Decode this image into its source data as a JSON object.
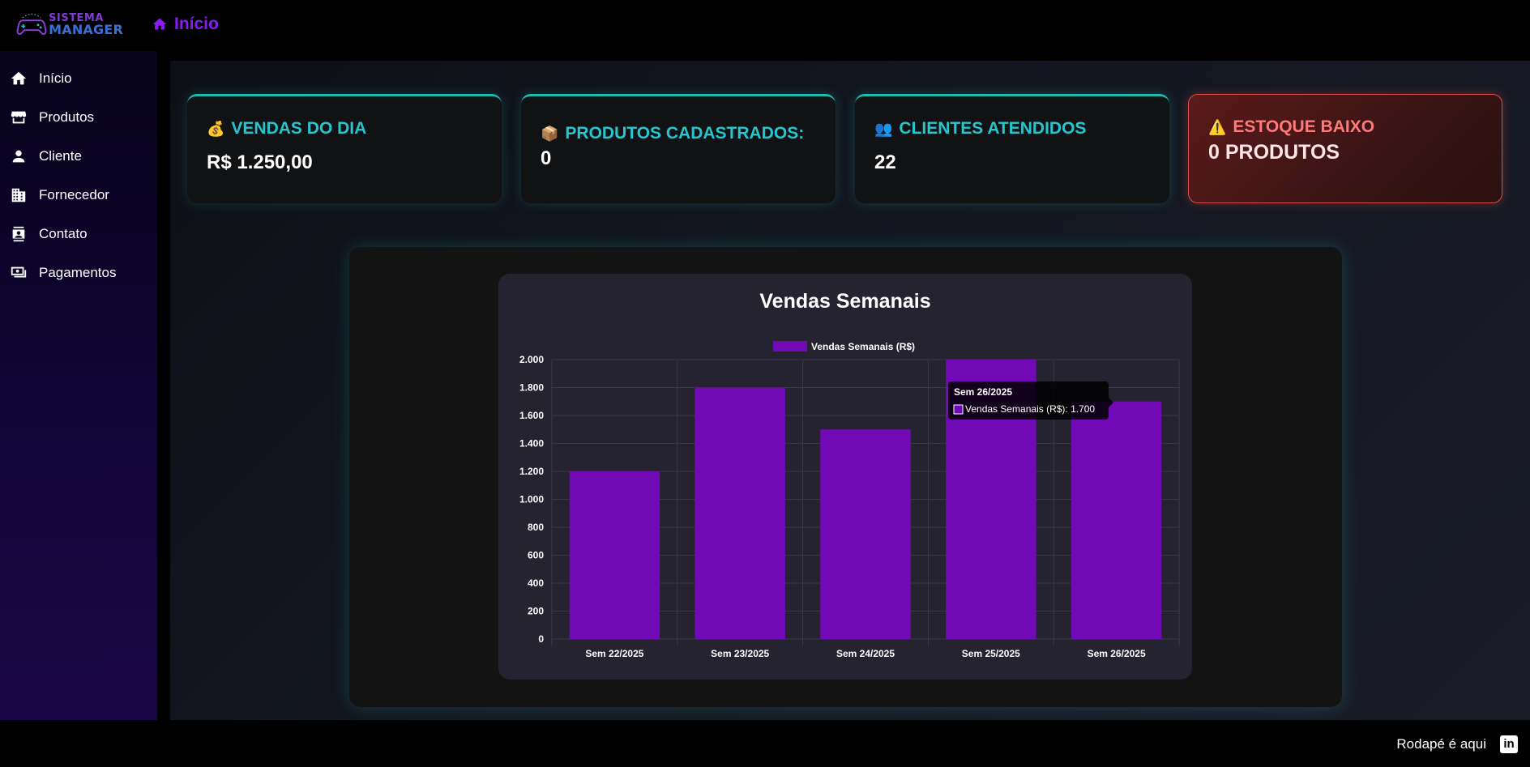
{
  "header": {
    "logo_top": "SISTEMA",
    "logo_bottom": "MANAGER",
    "page_title": "Início",
    "page_icon": "home-icon"
  },
  "sidebar": {
    "items": [
      {
        "label": "Início",
        "icon": "home-icon"
      },
      {
        "label": "Produtos",
        "icon": "store-icon"
      },
      {
        "label": "Cliente",
        "icon": "person-icon"
      },
      {
        "label": "Fornecedor",
        "icon": "building-icon"
      },
      {
        "label": "Contato",
        "icon": "contact-icon"
      },
      {
        "label": "Pagamentos",
        "icon": "payments-icon"
      }
    ]
  },
  "cards": [
    {
      "emoji": "💰",
      "title": "VENDAS DO DIA",
      "value": "R$ 1.250,00"
    },
    {
      "emoji": "📦",
      "title": "PRODUTOS CADASTRADOS:",
      "value": "0"
    },
    {
      "emoji": "👥",
      "title": "CLIENTES ATENDIDOS",
      "value": "22"
    },
    {
      "emoji": "⚠️",
      "title": "ESTOQUE BAIXO",
      "value": "0 PRODUTOS"
    }
  ],
  "chart": {
    "tooltip_title": "Sem 26/2025",
    "tooltip_label": "Vendas Semanais (R$): 1.700"
  },
  "chart_data": {
    "type": "bar",
    "title": "Vendas Semanais",
    "categories": [
      "Sem 22/2025",
      "Sem 23/2025",
      "Sem 24/2025",
      "Sem 25/2025",
      "Sem 26/2025"
    ],
    "series": [
      {
        "name": "Vendas Semanais (R$)",
        "values": [
          1200,
          1800,
          1500,
          2000,
          1700
        ]
      }
    ],
    "ylim": [
      0,
      2000
    ],
    "yticks": [
      "0",
      "200",
      "400",
      "600",
      "800",
      "1.000",
      "1.200",
      "1.400",
      "1.600",
      "1.800",
      "2.000"
    ],
    "legend": "top",
    "grid": true,
    "bar_color": "#7209b7"
  },
  "footer": {
    "text": "Rodapé é aqui",
    "icon": "linkedin-icon"
  },
  "colors": {
    "accent_purple": "#8a1bf5",
    "accent_teal": "#27c6cf",
    "alert_red": "#ff7a7a"
  }
}
